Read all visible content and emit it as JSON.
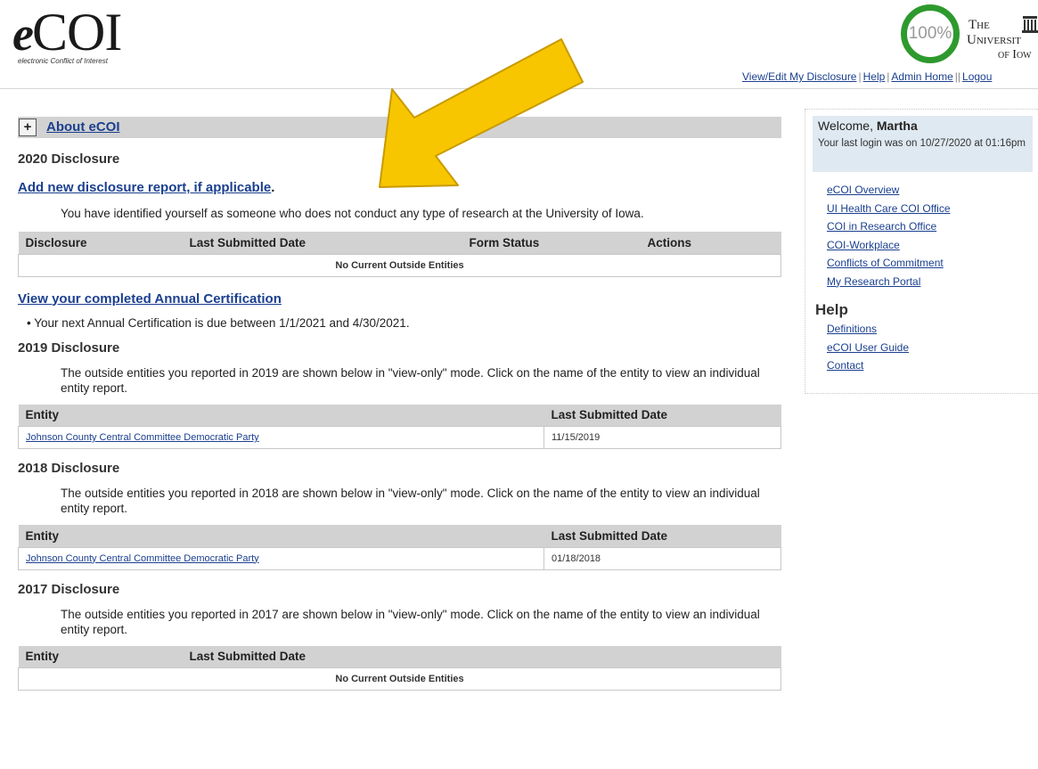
{
  "header": {
    "logo_e": "e",
    "logo_coi": "COI",
    "logo_tagline": "electronic Conflict of Interest",
    "progress": "100%",
    "uni_line1": "The",
    "uni_line2": "Universit",
    "uni_line3": "of Iow",
    "nav": {
      "view_edit": "View/Edit My Disclosure",
      "help": "Help",
      "admin_home": "Admin Home",
      "logout": "Logou"
    }
  },
  "main": {
    "about_toggle": "+",
    "about_link": "About eCOI",
    "d2020": {
      "heading": "2020 Disclosure",
      "add_link": "Add new disclosure report, if applicable",
      "add_link_suffix": ".",
      "note": "You have identified yourself as someone who does not conduct any type of research at the University of Iowa.",
      "table_headers": [
        "Disclosure",
        "Last Submitted Date",
        "Form Status",
        "Actions"
      ],
      "empty_row": "No Current Outside Entities"
    },
    "annual": {
      "link": "View your completed Annual Certification",
      "bullet": "Your next Annual Certification is due between 1/1/2021 and 4/30/2021."
    },
    "d2019": {
      "heading": "2019 Disclosure",
      "note": "The outside entities you reported in 2019 are shown below in \"view-only\" mode. Click on the name of the entity to view an individual entity report.",
      "table_headers": [
        "Entity",
        "Last Submitted Date"
      ],
      "entity": "Johnson County Central Committee Democratic Party",
      "date": "11/15/2019"
    },
    "d2018": {
      "heading": "2018 Disclosure",
      "note": "The outside entities you reported in 2018 are shown below in \"view-only\" mode. Click on the name of the entity to view an individual entity report.",
      "table_headers": [
        "Entity",
        "Last Submitted Date"
      ],
      "entity": "Johnson County Central Committee Democratic Party",
      "date": "01/18/2018"
    },
    "d2017": {
      "heading": "2017 Disclosure",
      "note": "The outside entities you reported in 2017 are shown below in \"view-only\" mode. Click on the name of the entity to view an individual entity report.",
      "table_headers": [
        "Entity",
        "Last Submitted Date"
      ],
      "empty_row": "No Current Outside Entities"
    }
  },
  "sidebar": {
    "welcome_prefix": "Welcome,",
    "user_name": "Martha",
    "last_login": "Your last login was on 10/27/2020 at 01:16pm",
    "links": [
      "eCOI Overview",
      "UI Health Care COI Office",
      "COI in Research Office",
      "COI-Workplace",
      "Conflicts of Commitment",
      "My Research Portal"
    ],
    "help_heading": "Help",
    "help_links": [
      "Definitions",
      "eCOI User Guide",
      "Contact"
    ]
  },
  "colors": {
    "progress_ring": "#2e9a2e",
    "link": "#1a3f8f",
    "arrow_fill": "#f7c600",
    "arrow_stroke": "#c99a00",
    "table_header_bg": "#d2d2d2",
    "welcome_bg": "#dfe9f1"
  },
  "icons": {
    "arrow": "annotation-arrow",
    "building": "old-capitol-building-icon"
  }
}
